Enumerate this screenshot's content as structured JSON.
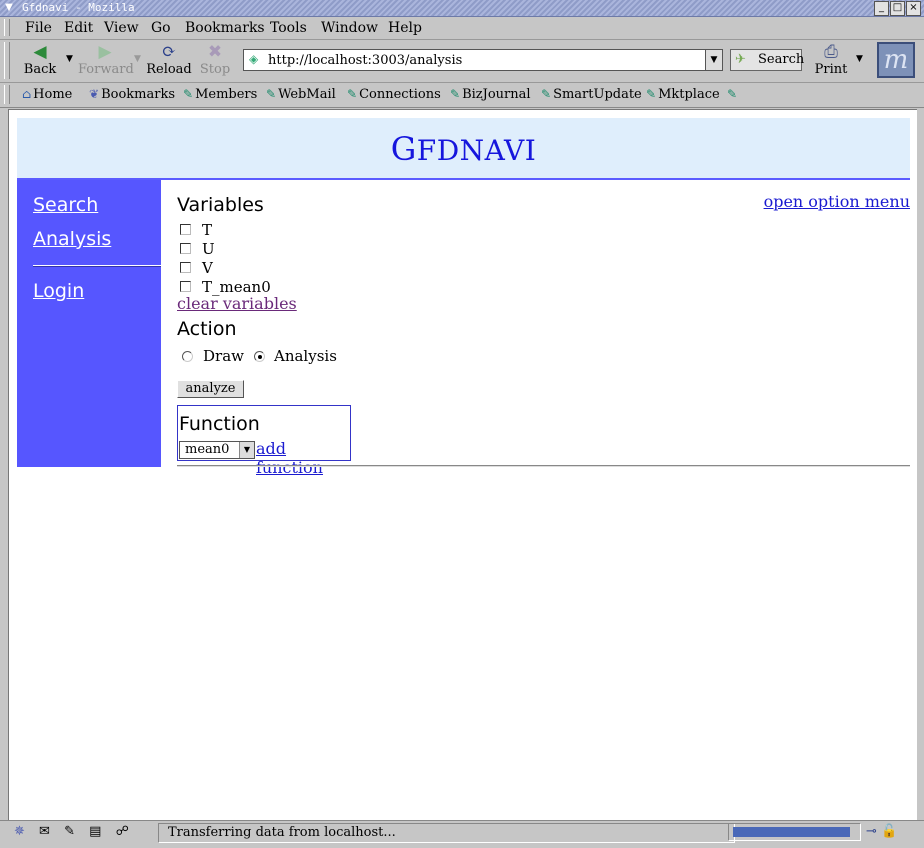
{
  "window": {
    "title": "Gfdnavi - Mozilla"
  },
  "menubar": [
    "File",
    "Edit",
    "View",
    "Go",
    "Bookmarks",
    "Tools",
    "Window",
    "Help"
  ],
  "nav": {
    "back": "Back",
    "forward": "Forward",
    "reload": "Reload",
    "stop": "Stop",
    "url": "http://localhost:3003/analysis",
    "search": "Search",
    "print": "Print"
  },
  "personal_toolbar": [
    "Home",
    "Bookmarks",
    "Members",
    "WebMail",
    "Connections",
    "BizJournal",
    "SmartUpdate",
    "Mktplace"
  ],
  "page": {
    "logo_first": "G",
    "logo_rest": "FDNAVI",
    "sidebar": {
      "search": "Search",
      "analysis": "Analysis",
      "login": "Login"
    },
    "open_option_menu": "open option menu",
    "variables_heading": "Variables",
    "variables": [
      "T",
      "U",
      "V",
      "T_mean0"
    ],
    "clear_variables": "clear variables",
    "action_heading": "Action",
    "action_draw": "Draw",
    "action_analysis": "Analysis",
    "analyze_button": "analyze",
    "function_heading": "Function",
    "function_selected": "mean0",
    "add_function": "add function"
  },
  "status": {
    "text": "Transferring data from localhost...",
    "progress": 0.95
  },
  "colors": {
    "banner_bg": "#dfeefc",
    "logo": "#1616dd",
    "sidebar_bg": "#5656ff",
    "link": "#1a1ad0",
    "visited_link": "#6a2a7a"
  }
}
